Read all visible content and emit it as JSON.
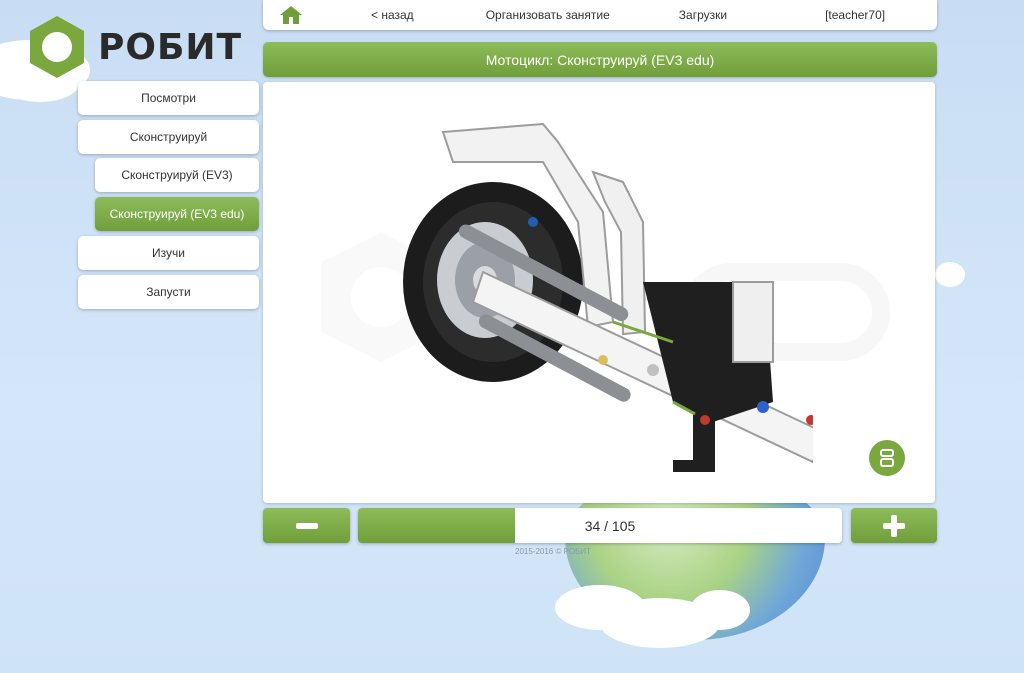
{
  "brand": {
    "name": "РОБИТ",
    "color": "#7aa83e"
  },
  "topnav": {
    "home_icon": "home-icon",
    "back": "< назад",
    "organize": "Организовать занятие",
    "downloads": "Загрузки",
    "user": "[teacher70]"
  },
  "title": "Мотоцикл: Сконструируй (EV3 edu)",
  "sidebar": {
    "items": [
      {
        "label": "Посмотри",
        "active": false
      },
      {
        "label": "Сконструируй",
        "active": false
      },
      {
        "label": "Сконструируй (EV3)",
        "active": false
      },
      {
        "label": "Сконструируй (EV3 edu)",
        "active": true
      },
      {
        "label": "Изучи",
        "active": false
      },
      {
        "label": "Запусти",
        "active": false
      }
    ]
  },
  "viewer": {
    "step_current": 34,
    "step_total": 105,
    "step_text": "34 / 105",
    "float_button_icon": "camera-rotate-icon"
  },
  "controls": {
    "minus_icon": "minus-icon",
    "plus_icon": "plus-icon"
  },
  "footer": "2015-2016 © РОБИТ"
}
